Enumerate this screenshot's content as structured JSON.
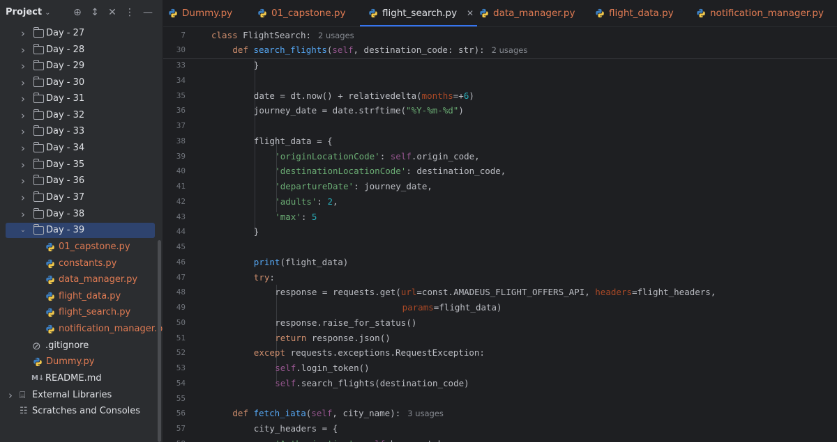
{
  "project_panel": {
    "title": "Project",
    "tree": [
      {
        "label": "Day - 27",
        "kind": "folder",
        "expanded": false
      },
      {
        "label": "Day - 28",
        "kind": "folder",
        "expanded": false
      },
      {
        "label": "Day - 29",
        "kind": "folder",
        "expanded": false
      },
      {
        "label": "Day - 30",
        "kind": "folder",
        "expanded": false
      },
      {
        "label": "Day - 31",
        "kind": "folder",
        "expanded": false
      },
      {
        "label": "Day - 32",
        "kind": "folder",
        "expanded": false
      },
      {
        "label": "Day - 33",
        "kind": "folder",
        "expanded": false
      },
      {
        "label": "Day - 34",
        "kind": "folder",
        "expanded": false
      },
      {
        "label": "Day - 35",
        "kind": "folder",
        "expanded": false
      },
      {
        "label": "Day - 36",
        "kind": "folder",
        "expanded": false
      },
      {
        "label": "Day - 37",
        "kind": "folder",
        "expanded": false
      },
      {
        "label": "Day - 38",
        "kind": "folder",
        "expanded": false
      },
      {
        "label": "Day - 39",
        "kind": "folder",
        "expanded": true,
        "selected": true
      },
      {
        "label": "01_capstone.py",
        "kind": "py",
        "depth": 2
      },
      {
        "label": "constants.py",
        "kind": "py",
        "depth": 2
      },
      {
        "label": "data_manager.py",
        "kind": "py",
        "depth": 2
      },
      {
        "label": "flight_data.py",
        "kind": "py",
        "depth": 2
      },
      {
        "label": "flight_search.py",
        "kind": "py",
        "depth": 2
      },
      {
        "label": "notification_manager.py",
        "kind": "py",
        "depth": 2
      },
      {
        "label": ".gitignore",
        "kind": "ignore",
        "depth": 1
      },
      {
        "label": "Dummy.py",
        "kind": "py",
        "depth": 1
      },
      {
        "label": "README.md",
        "kind": "md",
        "depth": 1
      },
      {
        "label": "External Libraries",
        "kind": "lib",
        "depth": 0
      },
      {
        "label": "Scratches and Consoles",
        "kind": "scratch",
        "depth": 0
      }
    ]
  },
  "tabs": [
    {
      "label": "Dummy.py",
      "active": false
    },
    {
      "label": "01_capstone.py",
      "active": false
    },
    {
      "label": "flight_search.py",
      "active": true
    },
    {
      "label": "data_manager.py",
      "active": false
    },
    {
      "label": "flight_data.py",
      "active": false
    },
    {
      "label": "notification_manager.py",
      "active": false
    }
  ],
  "editor": {
    "sticky_lines": [
      {
        "ln": "7",
        "indent": 2,
        "tokens": [
          [
            "kw",
            "class "
          ],
          [
            "",
            "FlightSearch:"
          ]
        ],
        "hint": "2 usages"
      },
      {
        "ln": "30",
        "indent": 3,
        "tokens": [
          [
            "kw",
            "def "
          ],
          [
            "fn",
            "search_flights"
          ],
          [
            "",
            "("
          ],
          [
            "self",
            "self"
          ],
          [
            "",
            ", destination_code: str):"
          ]
        ],
        "hint": "2 usages"
      }
    ],
    "lines": [
      {
        "ln": "33",
        "indent": 4,
        "tokens": [
          [
            "",
            "}"
          ]
        ]
      },
      {
        "ln": "34",
        "indent": 0,
        "tokens": []
      },
      {
        "ln": "35",
        "indent": 4,
        "tokens": [
          [
            "",
            "date = dt.now() + relativedelta("
          ],
          [
            "param",
            "months"
          ],
          [
            "",
            "=+"
          ],
          [
            "num",
            "6"
          ],
          [
            "",
            ")"
          ]
        ]
      },
      {
        "ln": "36",
        "indent": 4,
        "tokens": [
          [
            "",
            "journey_date = date.strftime("
          ],
          [
            "str",
            "\"%Y-%m-%d\""
          ],
          [
            "",
            ")"
          ]
        ]
      },
      {
        "ln": "37",
        "indent": 0,
        "tokens": []
      },
      {
        "ln": "38",
        "indent": 4,
        "tokens": [
          [
            "",
            "flight_data = {"
          ]
        ]
      },
      {
        "ln": "39",
        "indent": 5,
        "tokens": [
          [
            "str",
            "'originLocationCode'"
          ],
          [
            "",
            ": "
          ],
          [
            "self",
            "self"
          ],
          [
            "",
            ".origin_code,"
          ]
        ]
      },
      {
        "ln": "40",
        "indent": 5,
        "tokens": [
          [
            "str",
            "'destinationLocationCode'"
          ],
          [
            "",
            ": destination_code,"
          ]
        ]
      },
      {
        "ln": "41",
        "indent": 5,
        "tokens": [
          [
            "str",
            "'departureDate'"
          ],
          [
            "",
            ": journey_date,"
          ]
        ]
      },
      {
        "ln": "42",
        "indent": 5,
        "tokens": [
          [
            "str",
            "'adults'"
          ],
          [
            "",
            ": "
          ],
          [
            "num",
            "2"
          ],
          [
            "",
            ","
          ]
        ]
      },
      {
        "ln": "43",
        "indent": 5,
        "tokens": [
          [
            "str",
            "'max'"
          ],
          [
            "",
            ": "
          ],
          [
            "num",
            "5"
          ]
        ]
      },
      {
        "ln": "44",
        "indent": 4,
        "tokens": [
          [
            "",
            "}"
          ]
        ]
      },
      {
        "ln": "45",
        "indent": 0,
        "tokens": []
      },
      {
        "ln": "46",
        "indent": 4,
        "tokens": [
          [
            "fn2",
            "print"
          ],
          [
            "",
            "(flight_data)"
          ]
        ]
      },
      {
        "ln": "47",
        "indent": 4,
        "tokens": [
          [
            "kw",
            "try"
          ],
          [
            "",
            ":"
          ]
        ]
      },
      {
        "ln": "48",
        "indent": 5,
        "tokens": [
          [
            "",
            "response = requests.get("
          ],
          [
            "param",
            "url"
          ],
          [
            "",
            "=const.AMADEUS_FLIGHT_OFFERS_API, "
          ],
          [
            "param",
            "headers"
          ],
          [
            "",
            "=flight_headers,"
          ]
        ]
      },
      {
        "ln": "49",
        "indent": 11,
        "tokens": [
          [
            "param",
            "params"
          ],
          [
            "",
            "=flight_data)"
          ]
        ]
      },
      {
        "ln": "50",
        "indent": 5,
        "tokens": [
          [
            "",
            "response.raise_for_status()"
          ]
        ]
      },
      {
        "ln": "51",
        "indent": 5,
        "tokens": [
          [
            "kw",
            "return "
          ],
          [
            "",
            "response.json()"
          ]
        ]
      },
      {
        "ln": "52",
        "indent": 4,
        "tokens": [
          [
            "kw",
            "except "
          ],
          [
            "",
            "requests.exceptions.RequestException:"
          ]
        ]
      },
      {
        "ln": "53",
        "indent": 5,
        "tokens": [
          [
            "self",
            "self"
          ],
          [
            "",
            ".login_token()"
          ]
        ]
      },
      {
        "ln": "54",
        "indent": 5,
        "tokens": [
          [
            "self",
            "self"
          ],
          [
            "",
            ".search_flights(destination_code)"
          ]
        ]
      },
      {
        "ln": "55",
        "indent": 0,
        "tokens": []
      },
      {
        "ln": "56",
        "indent": 3,
        "tokens": [
          [
            "kw",
            "def "
          ],
          [
            "fn",
            "fetch_iata"
          ],
          [
            "",
            "("
          ],
          [
            "self",
            "self"
          ],
          [
            "",
            ", city_name):"
          ]
        ],
        "hint": "3 usages"
      },
      {
        "ln": "57",
        "indent": 4,
        "tokens": [
          [
            "",
            "city_headers = {"
          ]
        ]
      },
      {
        "ln": "58",
        "indent": 5,
        "tokens": [
          [
            "str",
            "'Authorization'"
          ],
          [
            "",
            ": "
          ],
          [
            "self",
            "self"
          ],
          [
            "",
            ".bearer_token,"
          ]
        ]
      }
    ]
  },
  "colors": {
    "accent": "#3574f0",
    "selection": "#2e436e",
    "python_file": "#e07b53"
  }
}
